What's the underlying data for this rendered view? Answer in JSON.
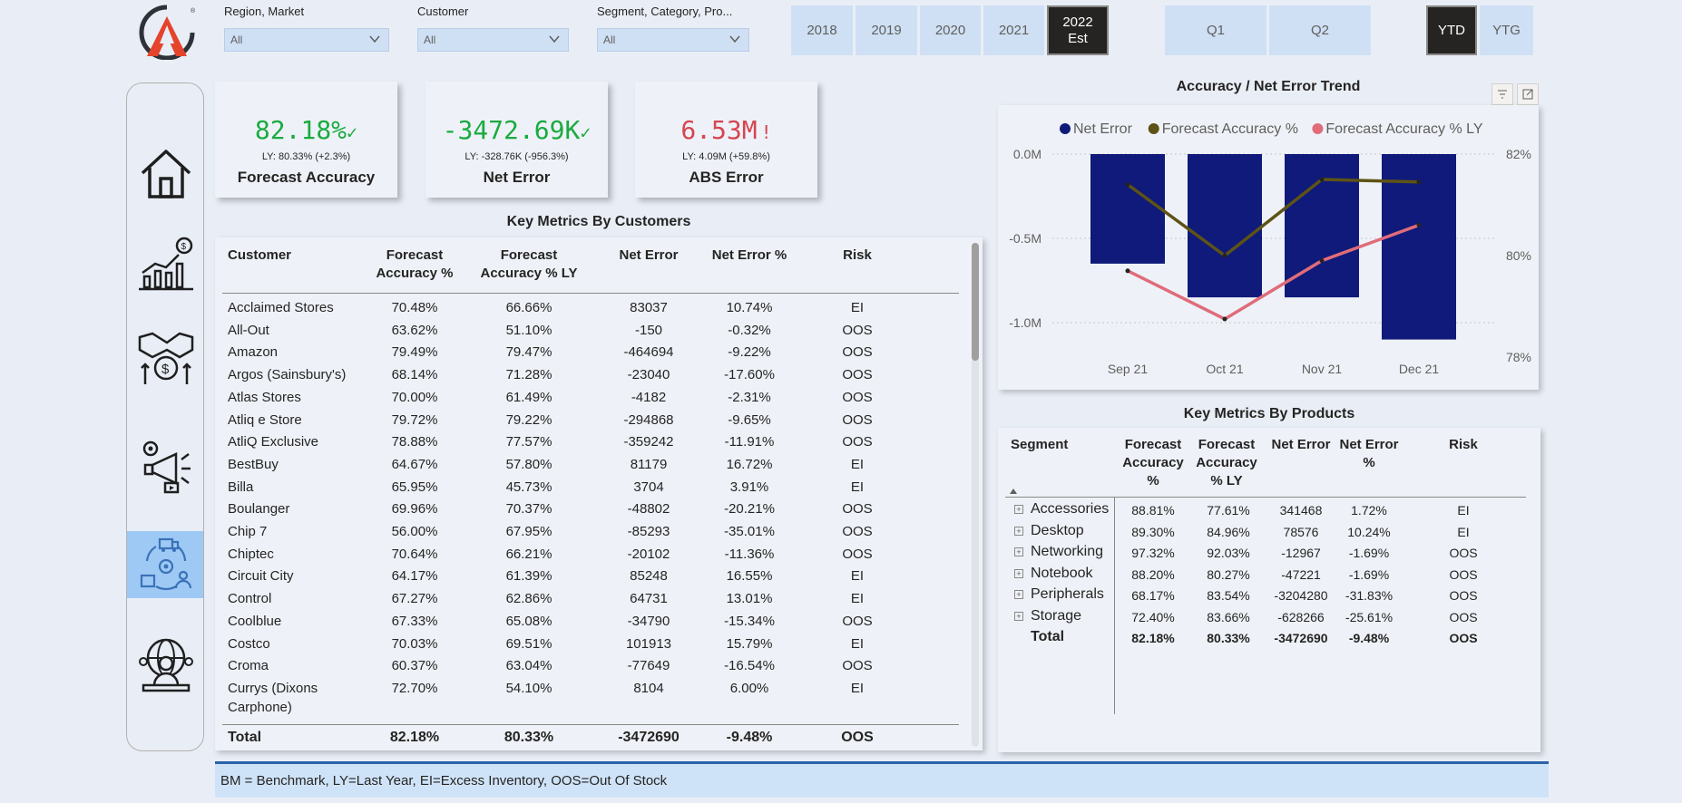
{
  "filters": [
    {
      "label": "Region, Market",
      "value": "All"
    },
    {
      "label": "Customer",
      "value": "All"
    },
    {
      "label": "Segment, Category, Pro...",
      "value": "All"
    }
  ],
  "years": [
    {
      "label": "2018",
      "active": false
    },
    {
      "label": "2019",
      "active": false
    },
    {
      "label": "2020",
      "active": false
    },
    {
      "label": "2021",
      "active": false
    },
    {
      "label": "2022",
      "label2": "Est",
      "active": true
    }
  ],
  "quarters": [
    "Q1",
    "Q2"
  ],
  "period": [
    {
      "label": "YTD",
      "active": true
    },
    {
      "label": "YTG",
      "active": false
    }
  ],
  "kpis": [
    {
      "value": "82.18%",
      "mark": "✓",
      "ly": "LY: 80.33% (+2.3%)",
      "name": "Forecast Accuracy",
      "color": "#1aab40"
    },
    {
      "value": "-3472.69K",
      "mark": "✓",
      "ly": "LY: -328.76K (-956.3%)",
      "name": "Net Error",
      "color": "#1aab40"
    },
    {
      "value": "6.53M",
      "mark": "!",
      "ly": "LY: 4.09M (+59.8%)",
      "name": "ABS Error",
      "color": "#d64550"
    }
  ],
  "customers_title": "Key Metrics By Customers",
  "customers_headers": [
    "Customer",
    "Forecast Accuracy %",
    "Forecast Accuracy % LY",
    "Net Error",
    "Net Error %",
    "Risk"
  ],
  "customers": [
    [
      "Acclaimed Stores",
      "70.48%",
      "66.66%",
      "83037",
      "10.74%",
      "EI"
    ],
    [
      "All-Out",
      "63.62%",
      "51.10%",
      "-150",
      "-0.32%",
      "OOS"
    ],
    [
      "Amazon",
      "79.49%",
      "79.47%",
      "-464694",
      "-9.22%",
      "OOS"
    ],
    [
      "Argos (Sainsbury's)",
      "68.14%",
      "71.28%",
      "-23040",
      "-17.60%",
      "OOS"
    ],
    [
      "Atlas Stores",
      "70.00%",
      "61.49%",
      "-4182",
      "-2.31%",
      "OOS"
    ],
    [
      "Atliq e Store",
      "79.72%",
      "79.22%",
      "-294868",
      "-9.65%",
      "OOS"
    ],
    [
      "AtliQ Exclusive",
      "78.88%",
      "77.57%",
      "-359242",
      "-11.91%",
      "OOS"
    ],
    [
      "BestBuy",
      "64.67%",
      "57.80%",
      "81179",
      "16.72%",
      "EI"
    ],
    [
      "Billa",
      "65.95%",
      "45.73%",
      "3704",
      "3.91%",
      "EI"
    ],
    [
      "Boulanger",
      "69.96%",
      "70.37%",
      "-48802",
      "-20.21%",
      "OOS"
    ],
    [
      "Chip 7",
      "56.00%",
      "67.95%",
      "-85293",
      "-35.01%",
      "OOS"
    ],
    [
      "Chiptec",
      "70.64%",
      "66.21%",
      "-20102",
      "-11.36%",
      "OOS"
    ],
    [
      "Circuit City",
      "64.17%",
      "61.39%",
      "85248",
      "16.55%",
      "EI"
    ],
    [
      "Control",
      "67.27%",
      "62.86%",
      "64731",
      "13.01%",
      "EI"
    ],
    [
      "Coolblue",
      "67.33%",
      "65.08%",
      "-34790",
      "-15.34%",
      "OOS"
    ],
    [
      "Costco",
      "70.03%",
      "69.51%",
      "101913",
      "15.79%",
      "EI"
    ],
    [
      "Croma",
      "60.37%",
      "63.04%",
      "-77649",
      "-16.54%",
      "OOS"
    ],
    [
      "Currys (Dixons",
      "72.70%",
      "54.10%",
      "8104",
      "6.00%",
      "EI"
    ]
  ],
  "customers_wrap": "Carphone)",
  "customers_total": [
    "Total",
    "82.18%",
    "80.33%",
    "-3472690",
    "-9.48%",
    "OOS"
  ],
  "chart_title": "Accuracy / Net Error Trend",
  "chart_data": {
    "type": "bar",
    "title": "Accuracy / Net Error Trend",
    "categories": [
      "Sep 21",
      "Oct 21",
      "Nov 21",
      "Dec 21"
    ],
    "series": [
      {
        "name": "Net Error",
        "kind": "bar",
        "axis": "left",
        "color": "#0f1a7a",
        "values": [
          -0.65,
          -0.85,
          -0.85,
          -1.1
        ]
      },
      {
        "name": "Forecast Accuracy %",
        "kind": "line",
        "axis": "right",
        "color": "#5e5316",
        "values": [
          81.4,
          80.0,
          81.5,
          81.45
        ]
      },
      {
        "name": "Forecast Accuracy % LY",
        "kind": "line",
        "axis": "right",
        "color": "#e06c7a",
        "values": [
          79.7,
          78.75,
          79.9,
          80.6
        ]
      }
    ],
    "y_left": {
      "ticks": [
        "0.0M",
        "-0.5M",
        "-1.0M"
      ],
      "range": [
        -1.2,
        0
      ]
    },
    "y_right": {
      "ticks": [
        "82%",
        "80%",
        "78%"
      ],
      "range": [
        78,
        82
      ]
    },
    "legend": "top",
    "grid": true
  },
  "products_title": "Key Metrics By Products",
  "products_headers": [
    "Segment",
    "Forecast Accuracy %",
    "Forecast Accuracy % LY",
    "Net Error",
    "Net Error %",
    "Risk"
  ],
  "products": [
    [
      "Accessories",
      "88.81%",
      "77.61%",
      "341468",
      "1.72%",
      "EI"
    ],
    [
      "Desktop",
      "89.30%",
      "84.96%",
      "78576",
      "10.24%",
      "EI"
    ],
    [
      "Networking",
      "97.32%",
      "92.03%",
      "-12967",
      "-1.69%",
      "OOS"
    ],
    [
      "Notebook",
      "88.20%",
      "80.27%",
      "-47221",
      "-1.69%",
      "OOS"
    ],
    [
      "Peripherals",
      "68.17%",
      "83.54%",
      "-3204280",
      "-31.83%",
      "OOS"
    ],
    [
      "Storage",
      "72.40%",
      "83.66%",
      "-628266",
      "-25.61%",
      "OOS"
    ]
  ],
  "products_total": [
    "Total",
    "82.18%",
    "80.33%",
    "-3472690",
    "-9.48%",
    "OOS"
  ],
  "footer": "BM = Benchmark, LY=Last Year, EI=Excess Inventory, OOS=Out Of Stock"
}
